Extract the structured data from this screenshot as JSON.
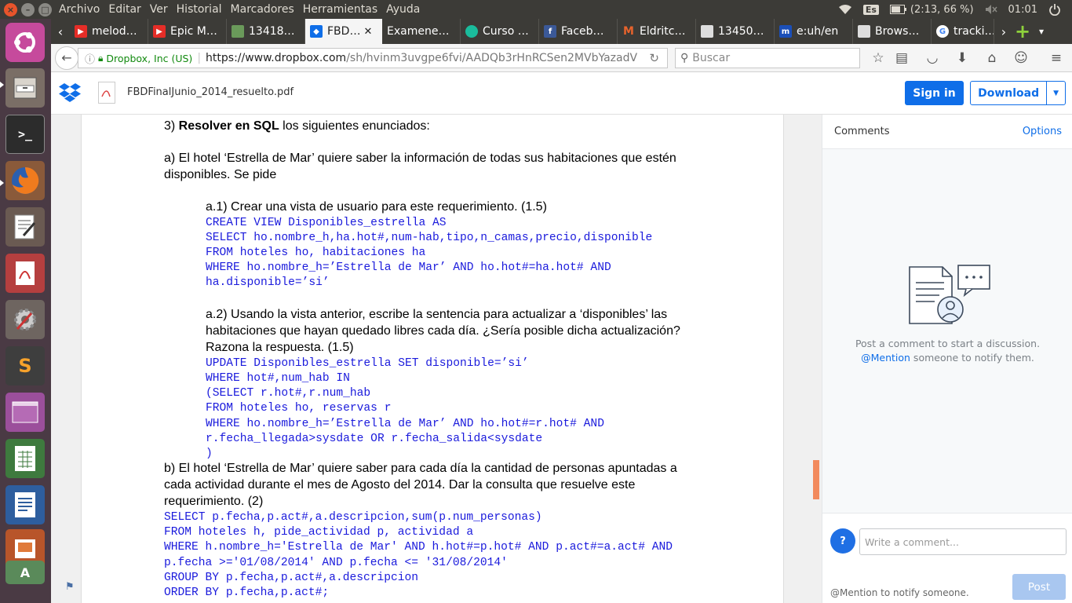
{
  "topbar": {
    "menu": [
      "Archivo",
      "Editar",
      "Ver",
      "Historial",
      "Marcadores",
      "Herramientas",
      "Ayuda"
    ],
    "keyboard": "Es",
    "battery": "(2:13, 66 %)",
    "clock": "01:01"
  },
  "tabs": [
    {
      "label": "melod…",
      "icon": "youtube-icon",
      "color": "#e52d27"
    },
    {
      "label": "Epic M…",
      "icon": "youtube-icon",
      "color": "#e52d27"
    },
    {
      "label": "13418…",
      "icon": "image-icon",
      "color": "#6a9a5a"
    },
    {
      "label": "FBD…",
      "icon": "dropbox-icon",
      "color": "#0f6ee8"
    },
    {
      "label": "Examene…",
      "icon": "blank-icon",
      "color": "#3c3b37"
    },
    {
      "label": "Curso …",
      "icon": "course-icon",
      "color": "#1abc9c"
    },
    {
      "label": "Faceb…",
      "icon": "facebook-icon",
      "color": "#3b5998"
    },
    {
      "label": "Eldritc…",
      "icon": "m-icon",
      "color": "#e8632c"
    },
    {
      "label": "13450…",
      "icon": "doc-icon",
      "color": "#dddddd"
    },
    {
      "label": "e:uh/en",
      "icon": "m-blue-icon",
      "color": "#1b4fb8"
    },
    {
      "label": "Brows…",
      "icon": "doc-icon",
      "color": "#dddddd"
    },
    {
      "label": "tracki…",
      "icon": "google-icon",
      "color": "#4285f4"
    }
  ],
  "navbar": {
    "identity": "Dropbox, Inc (US)",
    "url_host": "https://www.dropbox.com",
    "url_rest": "/sh/hvinm3uvgpe6fvi/AADQb3rHnRCSen2MVbYazadV",
    "search_placeholder": "Buscar"
  },
  "dropbox": {
    "filename": "FBDFinalJunio_2014_resuelto.pdf",
    "signin": "Sign in",
    "download": "Download"
  },
  "doc": {
    "l1_num": "3) ",
    "l1_bold": "Resolver en SQL",
    "l1_rest": " los siguientes enunciados:",
    "a1": "a) El hotel ‘Estrella de Mar’ quiere saber la información de todas sus habitaciones que estén",
    "a2": "disponibles. Se pide",
    "a11": "a.1) Crear una vista de usuario para este requerimiento. (1.5)",
    "c1": "CREATE VIEW Disponibles_estrella AS",
    "c2": "SELECT ho.nombre_h,ha.hot#,num-hab,tipo,n_camas,precio,disponible",
    "c3": "FROM hoteles ho, habitaciones ha",
    "c4": "WHERE ho.nombre_h=’Estrella de Mar’ AND ho.hot#=ha.hot# AND",
    "c5": "ha.disponible=’si’",
    "a21": "a.2) Usando la vista anterior, escribe la sentencia para actualizar a ‘disponibles’ las",
    "a22": "habitaciones que hayan quedado libres cada día. ¿Sería posible dicha actualización?",
    "a23": "Razona la respuesta. (1.5)",
    "u1": "UPDATE Disponibles_estrella SET disponible=’si’",
    "u2": "WHERE hot#,num_hab IN",
    "u3": "(SELECT r.hot#,r.num_hab",
    "u4": "FROM hoteles ho, reservas r",
    "u5": "WHERE ho.nombre_h=’Estrella de Mar’ AND ho.hot#=r.hot# AND",
    "u6": "r.fecha_llegada>sysdate OR r.fecha_salida<sysdate",
    "u7": ")",
    "b1": "b) El hotel ‘Estrella de Mar’ quiere saber para cada día la cantidad de personas apuntadas a",
    "b2": "cada actividad durante el mes de Agosto del 2014.  Dar la consulta que resuelve este",
    "b3": "requerimiento. (2)",
    "s1": "SELECT p.fecha,p.act#,a.descripcion,sum(p.num_personas)",
    "s2": "FROM hoteles h, pide_actividad p, actividad a",
    "s3": "WHERE h.nombre_h='Estrella de Mar' AND h.hot#=p.hot# AND p.act#=a.act# AND",
    "s4": "p.fecha >='01/08/2014' AND p.fecha <= '31/08/2014'",
    "s5": "GROUP BY p.fecha,p.act#,a.descripcion",
    "s6": "ORDER BY p.fecha,p.act#;"
  },
  "comments": {
    "title": "Comments",
    "options": "Options",
    "empty_line1": "Post a comment to start a discussion.",
    "mention": "@Mention",
    "empty_line2_rest": " someone to notify them.",
    "avatar": "?",
    "input_placeholder": "Write a comment...",
    "hint": "@Mention to notify someone.",
    "post": "Post"
  },
  "colors": {
    "accent": "#0f6ee8",
    "code": "#1a1adc",
    "launcher": "#4a3a44",
    "panel": "#3c3b37"
  }
}
